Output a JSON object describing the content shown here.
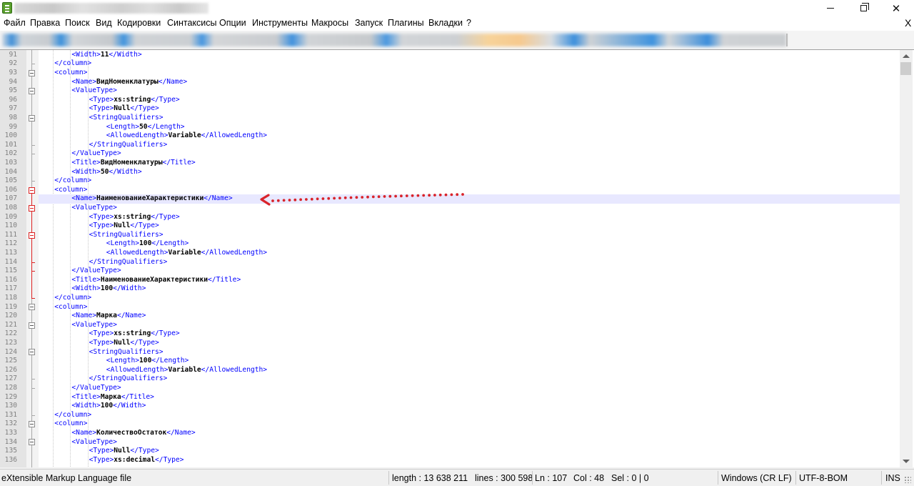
{
  "window": {
    "close_glyph": "✕",
    "doc_close_glyph": "X"
  },
  "menu": {
    "items": [
      "Файл",
      "Правка",
      "Поиск",
      "Вид",
      "Кодировки",
      "Синтаксисы",
      "Опции",
      "Инструменты",
      "Макросы",
      "Запуск",
      "Плагины",
      "Вкладки",
      "?"
    ]
  },
  "editor": {
    "current_line": 107,
    "lines": [
      {
        "n": "91",
        "indent": 2,
        "parts": [
          [
            "t",
            "<Width>"
          ],
          [
            "v",
            "11"
          ],
          [
            "t",
            "</Width>"
          ]
        ]
      },
      {
        "n": "92",
        "indent": 1,
        "parts": [
          [
            "t",
            "</column>"
          ]
        ]
      },
      {
        "n": "93",
        "indent": 1,
        "parts": [
          [
            "t",
            "<column>"
          ]
        ]
      },
      {
        "n": "94",
        "indent": 2,
        "parts": [
          [
            "t",
            "<Name>"
          ],
          [
            "v",
            "ВидНоменклатуры"
          ],
          [
            "t",
            "</Name>"
          ]
        ]
      },
      {
        "n": "95",
        "indent": 2,
        "parts": [
          [
            "t",
            "<ValueType>"
          ]
        ]
      },
      {
        "n": "96",
        "indent": 3,
        "parts": [
          [
            "t",
            "<Type>"
          ],
          [
            "v",
            "xs:string"
          ],
          [
            "t",
            "</Type>"
          ]
        ]
      },
      {
        "n": "97",
        "indent": 3,
        "parts": [
          [
            "t",
            "<Type>"
          ],
          [
            "v",
            "Null"
          ],
          [
            "t",
            "</Type>"
          ]
        ]
      },
      {
        "n": "98",
        "indent": 3,
        "parts": [
          [
            "t",
            "<StringQualifiers>"
          ]
        ]
      },
      {
        "n": "99",
        "indent": 4,
        "parts": [
          [
            "t",
            "<Length>"
          ],
          [
            "v",
            "50"
          ],
          [
            "t",
            "</Length>"
          ]
        ]
      },
      {
        "n": "100",
        "indent": 4,
        "parts": [
          [
            "t",
            "<AllowedLength>"
          ],
          [
            "v",
            "Variable"
          ],
          [
            "t",
            "</AllowedLength>"
          ]
        ]
      },
      {
        "n": "101",
        "indent": 3,
        "parts": [
          [
            "t",
            "</StringQualifiers>"
          ]
        ]
      },
      {
        "n": "102",
        "indent": 2,
        "parts": [
          [
            "t",
            "</ValueType>"
          ]
        ]
      },
      {
        "n": "103",
        "indent": 2,
        "parts": [
          [
            "t",
            "<Title>"
          ],
          [
            "v",
            "ВидНоменклатуры"
          ],
          [
            "t",
            "</Title>"
          ]
        ]
      },
      {
        "n": "104",
        "indent": 2,
        "parts": [
          [
            "t",
            "<Width>"
          ],
          [
            "v",
            "50"
          ],
          [
            "t",
            "</Width>"
          ]
        ]
      },
      {
        "n": "105",
        "indent": 1,
        "parts": [
          [
            "t",
            "</column>"
          ]
        ]
      },
      {
        "n": "106",
        "indent": 1,
        "parts": [
          [
            "t",
            "<column>"
          ]
        ]
      },
      {
        "n": "107",
        "indent": 2,
        "parts": [
          [
            "t",
            "<Name>"
          ],
          [
            "v",
            "НаименованиеХарактеристики"
          ],
          [
            "t",
            "</Name>"
          ]
        ]
      },
      {
        "n": "108",
        "indent": 2,
        "parts": [
          [
            "t",
            "<ValueType>"
          ]
        ]
      },
      {
        "n": "109",
        "indent": 3,
        "parts": [
          [
            "t",
            "<Type>"
          ],
          [
            "v",
            "xs:string"
          ],
          [
            "t",
            "</Type>"
          ]
        ]
      },
      {
        "n": "110",
        "indent": 3,
        "parts": [
          [
            "t",
            "<Type>"
          ],
          [
            "v",
            "Null"
          ],
          [
            "t",
            "</Type>"
          ]
        ]
      },
      {
        "n": "111",
        "indent": 3,
        "parts": [
          [
            "t",
            "<StringQualifiers>"
          ]
        ]
      },
      {
        "n": "112",
        "indent": 4,
        "parts": [
          [
            "t",
            "<Length>"
          ],
          [
            "v",
            "100"
          ],
          [
            "t",
            "</Length>"
          ]
        ]
      },
      {
        "n": "113",
        "indent": 4,
        "parts": [
          [
            "t",
            "<AllowedLength>"
          ],
          [
            "v",
            "Variable"
          ],
          [
            "t",
            "</AllowedLength>"
          ]
        ]
      },
      {
        "n": "114",
        "indent": 3,
        "parts": [
          [
            "t",
            "</StringQualifiers>"
          ]
        ]
      },
      {
        "n": "115",
        "indent": 2,
        "parts": [
          [
            "t",
            "</ValueType>"
          ]
        ]
      },
      {
        "n": "116",
        "indent": 2,
        "parts": [
          [
            "t",
            "<Title>"
          ],
          [
            "v",
            "НаименованиеХарактеристики"
          ],
          [
            "t",
            "</Title>"
          ]
        ]
      },
      {
        "n": "117",
        "indent": 2,
        "parts": [
          [
            "t",
            "<Width>"
          ],
          [
            "v",
            "100"
          ],
          [
            "t",
            "</Width>"
          ]
        ]
      },
      {
        "n": "118",
        "indent": 1,
        "parts": [
          [
            "t",
            "</column>"
          ]
        ]
      },
      {
        "n": "119",
        "indent": 1,
        "parts": [
          [
            "t",
            "<column>"
          ]
        ]
      },
      {
        "n": "120",
        "indent": 2,
        "parts": [
          [
            "t",
            "<Name>"
          ],
          [
            "v",
            "Марка"
          ],
          [
            "t",
            "</Name>"
          ]
        ]
      },
      {
        "n": "121",
        "indent": 2,
        "parts": [
          [
            "t",
            "<ValueType>"
          ]
        ]
      },
      {
        "n": "122",
        "indent": 3,
        "parts": [
          [
            "t",
            "<Type>"
          ],
          [
            "v",
            "xs:string"
          ],
          [
            "t",
            "</Type>"
          ]
        ]
      },
      {
        "n": "123",
        "indent": 3,
        "parts": [
          [
            "t",
            "<Type>"
          ],
          [
            "v",
            "Null"
          ],
          [
            "t",
            "</Type>"
          ]
        ]
      },
      {
        "n": "124",
        "indent": 3,
        "parts": [
          [
            "t",
            "<StringQualifiers>"
          ]
        ]
      },
      {
        "n": "125",
        "indent": 4,
        "parts": [
          [
            "t",
            "<Length>"
          ],
          [
            "v",
            "100"
          ],
          [
            "t",
            "</Length>"
          ]
        ]
      },
      {
        "n": "126",
        "indent": 4,
        "parts": [
          [
            "t",
            "<AllowedLength>"
          ],
          [
            "v",
            "Variable"
          ],
          [
            "t",
            "</AllowedLength>"
          ]
        ]
      },
      {
        "n": "127",
        "indent": 3,
        "parts": [
          [
            "t",
            "</StringQualifiers>"
          ]
        ]
      },
      {
        "n": "128",
        "indent": 2,
        "parts": [
          [
            "t",
            "</ValueType>"
          ]
        ]
      },
      {
        "n": "129",
        "indent": 2,
        "parts": [
          [
            "t",
            "<Title>"
          ],
          [
            "v",
            "Марка"
          ],
          [
            "t",
            "</Title>"
          ]
        ]
      },
      {
        "n": "130",
        "indent": 2,
        "parts": [
          [
            "t",
            "<Width>"
          ],
          [
            "v",
            "100"
          ],
          [
            "t",
            "</Width>"
          ]
        ]
      },
      {
        "n": "131",
        "indent": 1,
        "parts": [
          [
            "t",
            "</column>"
          ]
        ]
      },
      {
        "n": "132",
        "indent": 1,
        "parts": [
          [
            "t",
            "<column>"
          ]
        ]
      },
      {
        "n": "133",
        "indent": 2,
        "parts": [
          [
            "t",
            "<Name>"
          ],
          [
            "v",
            "КоличествоОстаток"
          ],
          [
            "t",
            "</Name>"
          ]
        ]
      },
      {
        "n": "134",
        "indent": 2,
        "parts": [
          [
            "t",
            "<ValueType>"
          ]
        ]
      },
      {
        "n": "135",
        "indent": 3,
        "parts": [
          [
            "t",
            "<Type>"
          ],
          [
            "v",
            "Null"
          ],
          [
            "t",
            "</Type>"
          ]
        ]
      },
      {
        "n": "136",
        "indent": 3,
        "parts": [
          [
            "t",
            "<Type>"
          ],
          [
            "v",
            "xs:decimal"
          ],
          [
            "t",
            "</Type>"
          ]
        ]
      }
    ]
  },
  "statusbar": {
    "language": "eXtensible Markup Language file",
    "length": "length : 13 638 211",
    "lines": "lines : 300 598",
    "ln": "Ln : 107",
    "col": "Col : 48",
    "sel": "Sel : 0 | 0",
    "eol": "Windows (CR LF)",
    "encoding": "UTF-8-BOM",
    "mode": "INS"
  },
  "colors": {
    "tag": "#0000ff",
    "text": "#000000",
    "line_number": "#808080",
    "current_line_bg": "#e8e8ff",
    "annotation_arrow": "#d9232a"
  }
}
